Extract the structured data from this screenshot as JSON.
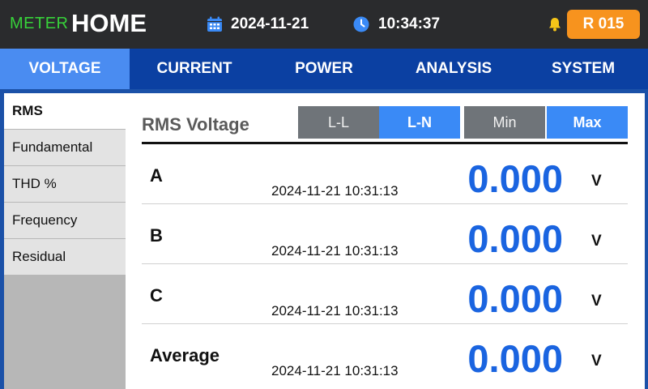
{
  "header": {
    "brand_meter": "METER",
    "brand_home": "HOME",
    "date": "2024-11-21",
    "time": "10:34:37",
    "record_badge": "R 015",
    "icons": [
      "calendar-icon",
      "clock-icon",
      "bell-icon"
    ]
  },
  "tabs": [
    {
      "label": "VOLTAGE",
      "active": true
    },
    {
      "label": "CURRENT",
      "active": false
    },
    {
      "label": "POWER",
      "active": false
    },
    {
      "label": "ANALYSIS",
      "active": false
    },
    {
      "label": "SYSTEM",
      "active": false
    }
  ],
  "sidebar": {
    "items": [
      {
        "label": "RMS",
        "active": true
      },
      {
        "label": "Fundamental",
        "active": false
      },
      {
        "label": "THD %",
        "active": false
      },
      {
        "label": "Frequency",
        "active": false
      },
      {
        "label": "Residual",
        "active": false
      }
    ]
  },
  "main": {
    "title": "RMS Voltage",
    "segments": [
      {
        "label": "L-L",
        "selected": false
      },
      {
        "label": "L-N",
        "selected": true
      },
      {
        "label": "Min",
        "selected": false
      },
      {
        "label": "Max",
        "selected": true
      }
    ],
    "rows": [
      {
        "label": "A",
        "timestamp": "2024-11-21 10:31:13",
        "value": "0.000",
        "unit": "V"
      },
      {
        "label": "B",
        "timestamp": "2024-11-21 10:31:13",
        "value": "0.000",
        "unit": "V"
      },
      {
        "label": "C",
        "timestamp": "2024-11-21 10:31:13",
        "value": "0.000",
        "unit": "V"
      },
      {
        "label": "Average",
        "timestamp": "2024-11-21 10:31:13",
        "value": "0.000",
        "unit": "V"
      }
    ]
  },
  "colors": {
    "header_bg": "#2a2b2d",
    "tab_bar": "#0b40a2",
    "tab_active": "#4a8cf1",
    "accent_blue": "#3a8af6",
    "value_blue": "#1a64e0",
    "brand_green": "#37d23a",
    "badge_orange": "#f7931e",
    "bell_yellow": "#f5c518"
  }
}
